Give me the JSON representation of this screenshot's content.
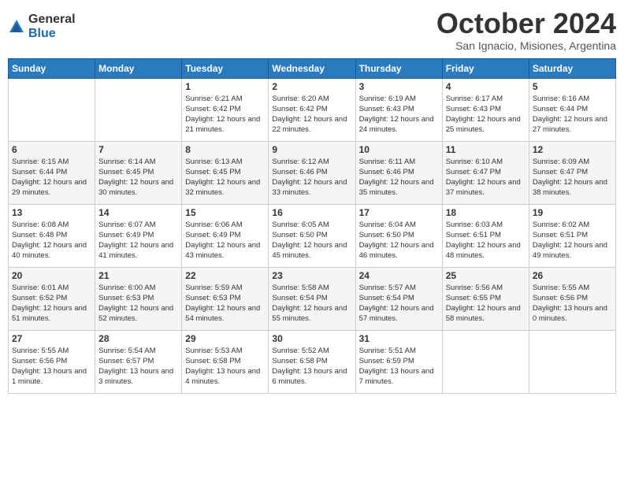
{
  "logo": {
    "general": "General",
    "blue": "Blue"
  },
  "title": "October 2024",
  "subtitle": "San Ignacio, Misiones, Argentina",
  "headers": [
    "Sunday",
    "Monday",
    "Tuesday",
    "Wednesday",
    "Thursday",
    "Friday",
    "Saturday"
  ],
  "weeks": [
    [
      {
        "day": "",
        "info": ""
      },
      {
        "day": "",
        "info": ""
      },
      {
        "day": "1",
        "info": "Sunrise: 6:21 AM\nSunset: 6:42 PM\nDaylight: 12 hours and 21 minutes."
      },
      {
        "day": "2",
        "info": "Sunrise: 6:20 AM\nSunset: 6:42 PM\nDaylight: 12 hours and 22 minutes."
      },
      {
        "day": "3",
        "info": "Sunrise: 6:19 AM\nSunset: 6:43 PM\nDaylight: 12 hours and 24 minutes."
      },
      {
        "day": "4",
        "info": "Sunrise: 6:17 AM\nSunset: 6:43 PM\nDaylight: 12 hours and 25 minutes."
      },
      {
        "day": "5",
        "info": "Sunrise: 6:16 AM\nSunset: 6:44 PM\nDaylight: 12 hours and 27 minutes."
      }
    ],
    [
      {
        "day": "6",
        "info": "Sunrise: 6:15 AM\nSunset: 6:44 PM\nDaylight: 12 hours and 29 minutes."
      },
      {
        "day": "7",
        "info": "Sunrise: 6:14 AM\nSunset: 6:45 PM\nDaylight: 12 hours and 30 minutes."
      },
      {
        "day": "8",
        "info": "Sunrise: 6:13 AM\nSunset: 6:45 PM\nDaylight: 12 hours and 32 minutes."
      },
      {
        "day": "9",
        "info": "Sunrise: 6:12 AM\nSunset: 6:46 PM\nDaylight: 12 hours and 33 minutes."
      },
      {
        "day": "10",
        "info": "Sunrise: 6:11 AM\nSunset: 6:46 PM\nDaylight: 12 hours and 35 minutes."
      },
      {
        "day": "11",
        "info": "Sunrise: 6:10 AM\nSunset: 6:47 PM\nDaylight: 12 hours and 37 minutes."
      },
      {
        "day": "12",
        "info": "Sunrise: 6:09 AM\nSunset: 6:47 PM\nDaylight: 12 hours and 38 minutes."
      }
    ],
    [
      {
        "day": "13",
        "info": "Sunrise: 6:08 AM\nSunset: 6:48 PM\nDaylight: 12 hours and 40 minutes."
      },
      {
        "day": "14",
        "info": "Sunrise: 6:07 AM\nSunset: 6:49 PM\nDaylight: 12 hours and 41 minutes."
      },
      {
        "day": "15",
        "info": "Sunrise: 6:06 AM\nSunset: 6:49 PM\nDaylight: 12 hours and 43 minutes."
      },
      {
        "day": "16",
        "info": "Sunrise: 6:05 AM\nSunset: 6:50 PM\nDaylight: 12 hours and 45 minutes."
      },
      {
        "day": "17",
        "info": "Sunrise: 6:04 AM\nSunset: 6:50 PM\nDaylight: 12 hours and 46 minutes."
      },
      {
        "day": "18",
        "info": "Sunrise: 6:03 AM\nSunset: 6:51 PM\nDaylight: 12 hours and 48 minutes."
      },
      {
        "day": "19",
        "info": "Sunrise: 6:02 AM\nSunset: 6:51 PM\nDaylight: 12 hours and 49 minutes."
      }
    ],
    [
      {
        "day": "20",
        "info": "Sunrise: 6:01 AM\nSunset: 6:52 PM\nDaylight: 12 hours and 51 minutes."
      },
      {
        "day": "21",
        "info": "Sunrise: 6:00 AM\nSunset: 6:53 PM\nDaylight: 12 hours and 52 minutes."
      },
      {
        "day": "22",
        "info": "Sunrise: 5:59 AM\nSunset: 6:53 PM\nDaylight: 12 hours and 54 minutes."
      },
      {
        "day": "23",
        "info": "Sunrise: 5:58 AM\nSunset: 6:54 PM\nDaylight: 12 hours and 55 minutes."
      },
      {
        "day": "24",
        "info": "Sunrise: 5:57 AM\nSunset: 6:54 PM\nDaylight: 12 hours and 57 minutes."
      },
      {
        "day": "25",
        "info": "Sunrise: 5:56 AM\nSunset: 6:55 PM\nDaylight: 12 hours and 58 minutes."
      },
      {
        "day": "26",
        "info": "Sunrise: 5:55 AM\nSunset: 6:56 PM\nDaylight: 13 hours and 0 minutes."
      }
    ],
    [
      {
        "day": "27",
        "info": "Sunrise: 5:55 AM\nSunset: 6:56 PM\nDaylight: 13 hours and 1 minute."
      },
      {
        "day": "28",
        "info": "Sunrise: 5:54 AM\nSunset: 6:57 PM\nDaylight: 13 hours and 3 minutes."
      },
      {
        "day": "29",
        "info": "Sunrise: 5:53 AM\nSunset: 6:58 PM\nDaylight: 13 hours and 4 minutes."
      },
      {
        "day": "30",
        "info": "Sunrise: 5:52 AM\nSunset: 6:58 PM\nDaylight: 13 hours and 6 minutes."
      },
      {
        "day": "31",
        "info": "Sunrise: 5:51 AM\nSunset: 6:59 PM\nDaylight: 13 hours and 7 minutes."
      },
      {
        "day": "",
        "info": ""
      },
      {
        "day": "",
        "info": ""
      }
    ]
  ]
}
